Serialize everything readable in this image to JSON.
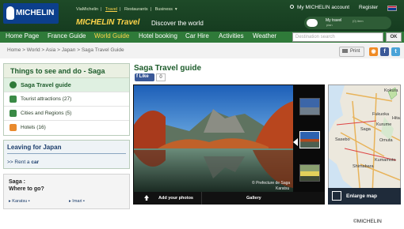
{
  "header": {
    "logo_text": "MICHELIN",
    "top_links": [
      "ViaMichelin",
      "Travel",
      "Restaurants",
      "Business"
    ],
    "current_link": "Travel",
    "brand": "MICHELIN Travel",
    "tagline": "Discover the world",
    "account_label": "My MICHELIN account",
    "register_label": "Register",
    "my_travel": {
      "title": "My travel",
      "sub": "plan",
      "count": "(0) item"
    }
  },
  "nav": {
    "items": [
      "Home Page",
      "France Guide",
      "World Guide",
      "Hotel booking",
      "Car Hire",
      "Activities",
      "Weather"
    ],
    "active": "World Guide",
    "search_placeholder": "Destination search",
    "ok_label": "OK"
  },
  "breadcrumb": {
    "text": "Home > World > Asia > Japan > Saga Travel Guide"
  },
  "tools": {
    "print_label": "Print"
  },
  "sidebar": {
    "things_title": "Things to see and do - Saga",
    "items": [
      {
        "label": "Saga Travel guide",
        "icon": "guide-icon",
        "selected": true
      },
      {
        "label": "Tourist attractions (27)",
        "icon": "attractions-icon",
        "selected": false
      },
      {
        "label": "Cities and Regions (5)",
        "icon": "cities-icon",
        "selected": false
      },
      {
        "label": "Hotels (16)",
        "icon": "hotel-icon",
        "selected": false
      }
    ],
    "leaving_title": "Leaving for Japan",
    "rent_prefix": ">> Rent a ",
    "rent_link": "car",
    "where_title": "Saga :",
    "where_sub": "Where to go?",
    "cities": [
      "Karatsu",
      "Imari"
    ]
  },
  "main": {
    "title": "Saga Travel guide",
    "like_label": "Like",
    "like_count": "0",
    "photo_credit": "© Prefecture de Saga",
    "photo_caption": "Karatsu",
    "add_photos_label": "Add your photos",
    "gallery_label": "Gallery",
    "enlarge_label": "Enlarge map",
    "map_labels": [
      "Kokura",
      "Fukuoka",
      "Kurume",
      "Saga",
      "Omuta",
      "Hita",
      "Sasebo",
      "Kumamoto",
      "Shimabara"
    ]
  },
  "footer": {
    "copyright": "©MICHELIN"
  },
  "colors": {
    "header_bg": "#1e4a28",
    "nav_bg": "#2f7a39",
    "active": "#ffd54a",
    "title_green": "#1d5c2b"
  }
}
